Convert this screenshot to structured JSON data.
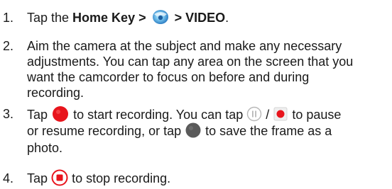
{
  "steps": [
    {
      "number": "1.",
      "text_a": "Tap the ",
      "bold_a": "Home Key >",
      "bold_b": "> VIDEO",
      "text_end": "."
    },
    {
      "number": "2.",
      "lines": [
        "Aim the camera at the subject and make any necessary",
        "adjustments. You can tap any area on the screen that you",
        "want the camcorder to focus on before and during",
        "recording."
      ]
    },
    {
      "number": "3.",
      "l1_a": "Tap",
      "l1_b": "to start recording. You can tap",
      "l1_c": "/",
      "l1_d": "to pause",
      "l2_a": "or resume recording, or tap",
      "l2_b": "to save the frame as a",
      "l3": "photo."
    },
    {
      "number": "4.",
      "a": "Tap",
      "b": "to stop recording."
    }
  ],
  "icons": {
    "camera_app": "camera-app-icon",
    "record": "record-icon",
    "pause": "pause-icon",
    "resume": "resume-icon",
    "snapshot": "snapshot-icon",
    "stop": "stop-icon"
  },
  "colors": {
    "text": "#1a1a1a",
    "record_red": "#e8141c",
    "snapshot_gray": "#5a5a5a",
    "camera_app_blue": "#3aa0e0"
  }
}
